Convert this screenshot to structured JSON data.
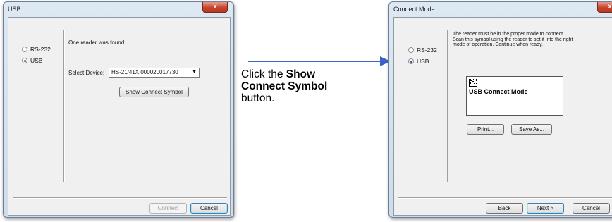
{
  "left_dialog": {
    "title": "USB",
    "close_glyph": "x",
    "radio_rs232": "RS-232",
    "radio_usb": "USB",
    "message": "One reader was found.",
    "select_label": "Select Device:",
    "select_value": "HS-21/41X 000020017730",
    "show_connect_button": "Show Connect Symbol",
    "connect_button": "Connect",
    "cancel_button": "Cancel"
  },
  "caption": {
    "prefix": "Click the ",
    "bold": "Show Connect Symbol",
    "suffix": " button."
  },
  "right_dialog": {
    "title": "Connect Mode",
    "close_glyph": "x",
    "radio_rs232": "RS-232",
    "radio_usb": "USB",
    "instructions": "The reader must be in the proper mode to connect. Scan this symbol using the reader to set it into the right mode of operation. Continue when ready.",
    "symbol_caption": "USB Connect Mode",
    "print_button": "Print...",
    "save_as_button": "Save As...",
    "back_button": "Back",
    "next_button": "Next >",
    "cancel_button": "Cancel"
  },
  "colors": {
    "arrow": "#3a64c5",
    "close_button": "#c8432f",
    "dialog_frame": "#cfdce9"
  },
  "icons": [
    "close-icon",
    "dropdown-arrow-icon",
    "data-matrix-icon",
    "arrow-right-icon"
  ]
}
